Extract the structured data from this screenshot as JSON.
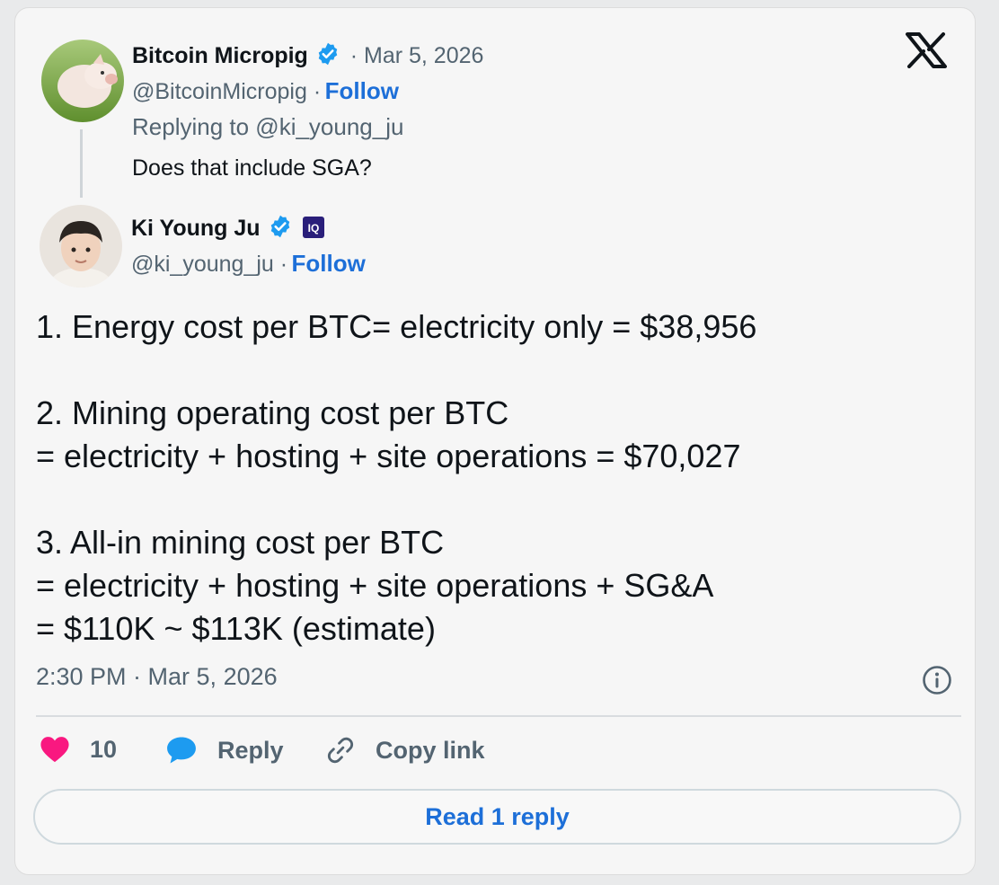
{
  "reply_tweet": {
    "author_name": "Bitcoin Micropig",
    "date": "· Mar 5, 2026",
    "handle": "@BitcoinMicropig ·",
    "follow_label": "Follow",
    "replying_to": "Replying to @ki_young_ju",
    "text": "Does that include SGA?"
  },
  "main_tweet": {
    "author_name": "Ki Young Ju",
    "handle": "@ki_young_ju ·",
    "follow_label": "Follow",
    "body": "1. Energy cost per BTC= electricity only = $38,956\n\n2. Mining operating cost per BTC\n= electricity + hosting + site operations = $70,027\n\n3. All-in mining cost per BTC\n= electricity + hosting + site operations + SG&A\n= $110K ~ $113K (estimate)",
    "timestamp": "2:30 PM · Mar 5, 2026"
  },
  "actions": {
    "like_count": "10",
    "reply_label": "Reply",
    "copy_link_label": "Copy link"
  },
  "read_replies_label": "Read 1 reply",
  "icons": {
    "logo": "x-logo-icon",
    "verified": "verified-badge-icon",
    "affiliate": "cryptoquant-affiliate-icon",
    "info": "info-icon",
    "like": "heart-icon",
    "reply": "speech-bubble-icon",
    "copy": "link-icon"
  },
  "colors": {
    "link_blue": "#1d6fd8",
    "verified_blue": "#1d9bf0",
    "heart_pink": "#f91880",
    "muted_text": "#536471"
  }
}
